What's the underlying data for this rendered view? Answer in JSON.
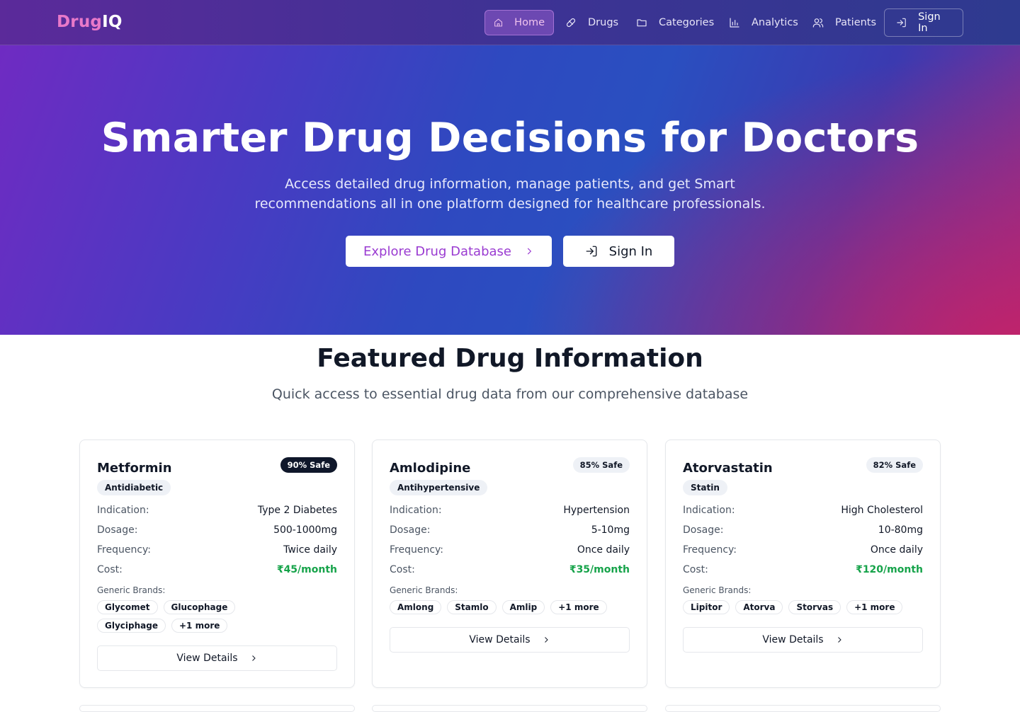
{
  "nav": {
    "logo_a": "Drug",
    "logo_b": "IQ",
    "items": [
      {
        "label": "Home",
        "icon": "home-icon"
      },
      {
        "label": "Drugs",
        "icon": "pill-icon"
      },
      {
        "label": "Categories",
        "icon": "folder-icon"
      },
      {
        "label": "Analytics",
        "icon": "bar-chart-icon"
      },
      {
        "label": "Patients",
        "icon": "users-icon"
      }
    ],
    "signin_label": "Sign In"
  },
  "hero": {
    "title": "Smarter Drug Decisions for Doctors",
    "subtitle_line1": "Access detailed drug information, manage patients, and get Smart",
    "subtitle_line2": "recommendations all in one platform designed for healthcare professionals.",
    "explore_label": "Explore Drug Database",
    "signin_label": "Sign In"
  },
  "featured": {
    "title": "Featured Drug Information",
    "subtitle": "Quick access to essential drug data from our comprehensive database",
    "labels": {
      "indication": "Indication:",
      "dosage": "Dosage:",
      "frequency": "Frequency:",
      "cost": "Cost:",
      "generic_brands": "Generic Brands:",
      "view_details": "View Details"
    },
    "cards": [
      {
        "name": "Metformin",
        "safe": "90% Safe",
        "category": "Antidiabetic",
        "indication": "Type 2 Diabetes",
        "dosage": "500-1000mg",
        "frequency": "Twice daily",
        "cost": "₹45/month",
        "brands": [
          "Glycomet",
          "Glucophage",
          "Glyciphage",
          "+1 more"
        ]
      },
      {
        "name": "Amlodipine",
        "safe": "85% Safe",
        "category": "Antihypertensive",
        "indication": "Hypertension",
        "dosage": "5-10mg",
        "frequency": "Once daily",
        "cost": "₹35/month",
        "brands": [
          "Amlong",
          "Stamlo",
          "Amlip",
          "+1 more"
        ]
      },
      {
        "name": "Atorvastatin",
        "safe": "82% Safe",
        "category": "Statin",
        "indication": "High Cholesterol",
        "dosage": "10-80mg",
        "frequency": "Once daily",
        "cost": "₹120/month",
        "brands": [
          "Lipitor",
          "Atorva",
          "Storvas",
          "+1 more"
        ]
      }
    ]
  },
  "colors": {
    "accent": "#9a3bd1",
    "cost_green": "#16a34a",
    "logo_pink": "#e879c9"
  }
}
